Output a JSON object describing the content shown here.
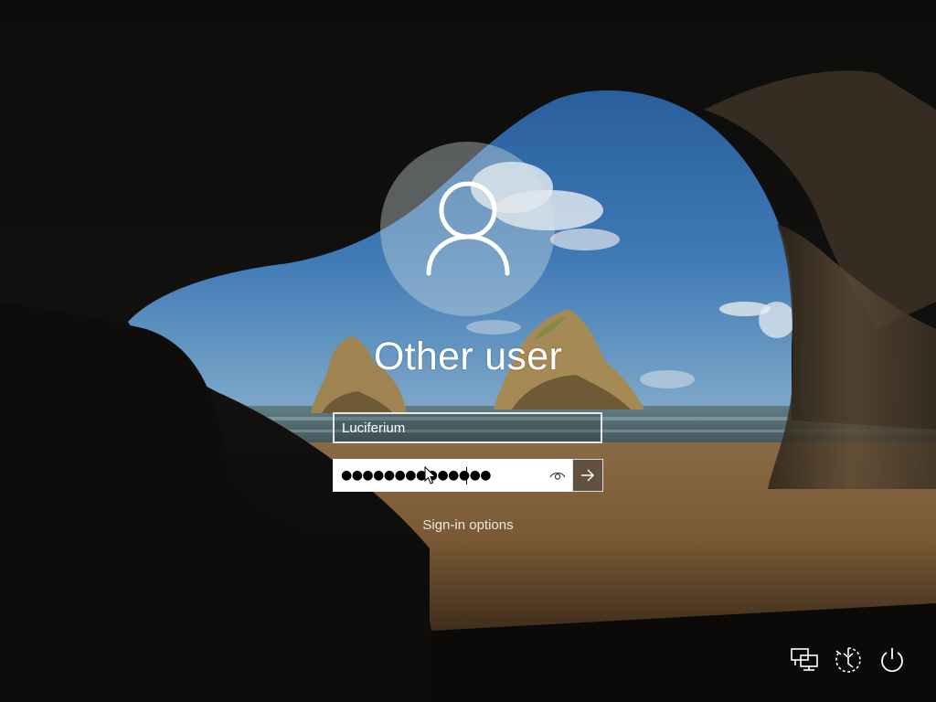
{
  "login": {
    "user_name": "Other user",
    "username_value": "Luciferium",
    "password_masked": "●●●●●●●●●●●●●●"
  },
  "links": {
    "sign_in_options": "Sign-in options"
  },
  "icons": {
    "avatar": "user-silhouette-icon",
    "reveal": "eye-icon",
    "submit": "arrow-right-icon",
    "network": "network-icon",
    "accessibility": "ease-of-access-icon",
    "power": "power-icon"
  },
  "colors": {
    "text": "#ffffff",
    "password_bg": "#ffffff",
    "submit_bg": "#5a4e40"
  }
}
